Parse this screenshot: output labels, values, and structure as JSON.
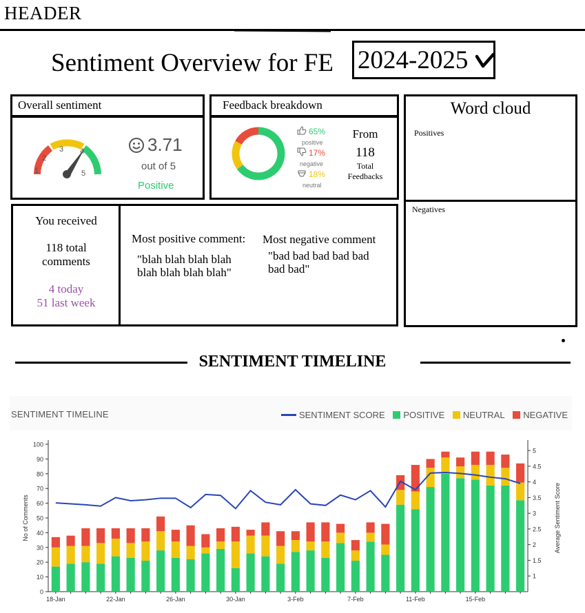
{
  "header": {
    "label": "HEADER"
  },
  "page": {
    "title": "Sentiment Overview for FE",
    "fiscal_year": "2024-2025"
  },
  "overall": {
    "title": "Overall sentiment",
    "gauge_ticks": [
      "1",
      "2",
      "3",
      "4",
      "5"
    ],
    "score": "3.71",
    "out_of": "out of 5",
    "label": "Positive",
    "gauge_value": 3.71,
    "colors": {
      "negative": "#e74c3c",
      "neutral": "#f1c40f",
      "positive": "#2ecc71",
      "needle": "#444444"
    }
  },
  "breakdown": {
    "title": "Feedback breakdown",
    "items": [
      {
        "pct": "65%",
        "label": "positive",
        "color": "#2ecc71",
        "value": 65
      },
      {
        "pct": "17%",
        "label": "negative",
        "color": "#e74c3c",
        "value": 17
      },
      {
        "pct": "18%",
        "label": "neutral",
        "color": "#f1c40f",
        "value": 18
      }
    ],
    "from": "From",
    "total": "118",
    "total_label_1": "Total",
    "total_label_2": "Feedbacks"
  },
  "received": {
    "title": "You received",
    "total_1": "118 total",
    "total_2": "comments",
    "today": "4 today",
    "last_week": "51 last week"
  },
  "comments": {
    "positive_label": "Most positive comment:",
    "positive_text": "\"blah blah blah blah blah blah blah blah\"",
    "negative_label": "Most negative comment",
    "negative_text": "\"bad bad bad bad bad bad bad\""
  },
  "word_cloud": {
    "title": "Word cloud",
    "positives": "Positives",
    "negatives": "Negatives"
  },
  "timeline": {
    "section_title": "SENTIMENT TIMELINE",
    "panel_title": "SENTIMENT TIMELINE",
    "legend": {
      "score": "SENTIMENT SCORE",
      "positive": "POSITIVE",
      "neutral": "NEUTRAL",
      "negative": "NEGATIVE"
    }
  },
  "chart_data": {
    "type": "bar",
    "stacked": true,
    "title": "SENTIMENT TIMELINE",
    "xlabel": "",
    "ylabel": "No of Comments",
    "y2label": "Average Sentiment Score",
    "ylim": [
      0,
      100
    ],
    "y2lim": [
      0.5,
      5.2
    ],
    "yticks": [
      "0",
      "10",
      "20",
      "30",
      "40",
      "50",
      "60",
      "70",
      "80",
      "90",
      "100"
    ],
    "y2ticks": [
      "1",
      "1.5",
      "2",
      "2.5",
      "3",
      "3.5",
      "4",
      "4.5",
      "5"
    ],
    "x_tick_labels": [
      {
        "index": 0,
        "label": "18-Jan"
      },
      {
        "index": 4,
        "label": "22-Jan"
      },
      {
        "index": 8,
        "label": "26-Jan"
      },
      {
        "index": 12,
        "label": "30-Jan"
      },
      {
        "index": 16,
        "label": "3-Feb"
      },
      {
        "index": 20,
        "label": "7-Feb"
      },
      {
        "index": 24,
        "label": "11-Feb"
      },
      {
        "index": 28,
        "label": "15-Feb"
      }
    ],
    "series": [
      {
        "name": "POSITIVE",
        "color": "#2ecc71",
        "values": [
          17,
          19,
          20,
          19,
          24,
          23,
          21,
          28,
          23,
          22,
          26,
          29,
          16,
          26,
          24,
          19,
          27,
          28,
          23,
          33,
          21,
          34,
          25,
          59,
          56,
          71,
          80,
          77,
          76,
          72,
          72,
          62
        ]
      },
      {
        "name": "NEUTRAL",
        "color": "#f1c40f",
        "values": [
          13,
          12,
          11,
          14,
          12,
          10,
          13,
          13,
          11,
          9,
          4,
          5,
          18,
          12,
          14,
          12,
          8,
          6,
          11,
          7,
          7,
          6,
          7,
          10,
          12,
          13,
          11,
          8,
          10,
          14,
          12,
          12
        ]
      },
      {
        "name": "NEGATIVE",
        "color": "#e74c3c",
        "values": [
          7,
          7,
          12,
          10,
          7,
          10,
          9,
          10,
          8,
          14,
          9,
          9,
          10,
          4,
          9,
          10,
          6,
          13,
          13,
          6,
          7,
          7,
          14,
          10,
          18,
          6,
          4,
          6,
          9,
          9,
          9,
          13
        ]
      },
      {
        "name": "SENTIMENT SCORE",
        "color": "#2845b8",
        "type": "line",
        "values": [
          3.33,
          3.3,
          3.27,
          3.23,
          3.5,
          3.4,
          3.43,
          3.48,
          3.48,
          3.18,
          3.6,
          3.57,
          3.15,
          3.72,
          3.35,
          3.27,
          3.75,
          3.3,
          3.25,
          3.58,
          3.43,
          3.72,
          3.2,
          4.02,
          3.75,
          4.28,
          4.3,
          4.27,
          4.22,
          4.15,
          4.1,
          3.95
        ]
      }
    ]
  }
}
